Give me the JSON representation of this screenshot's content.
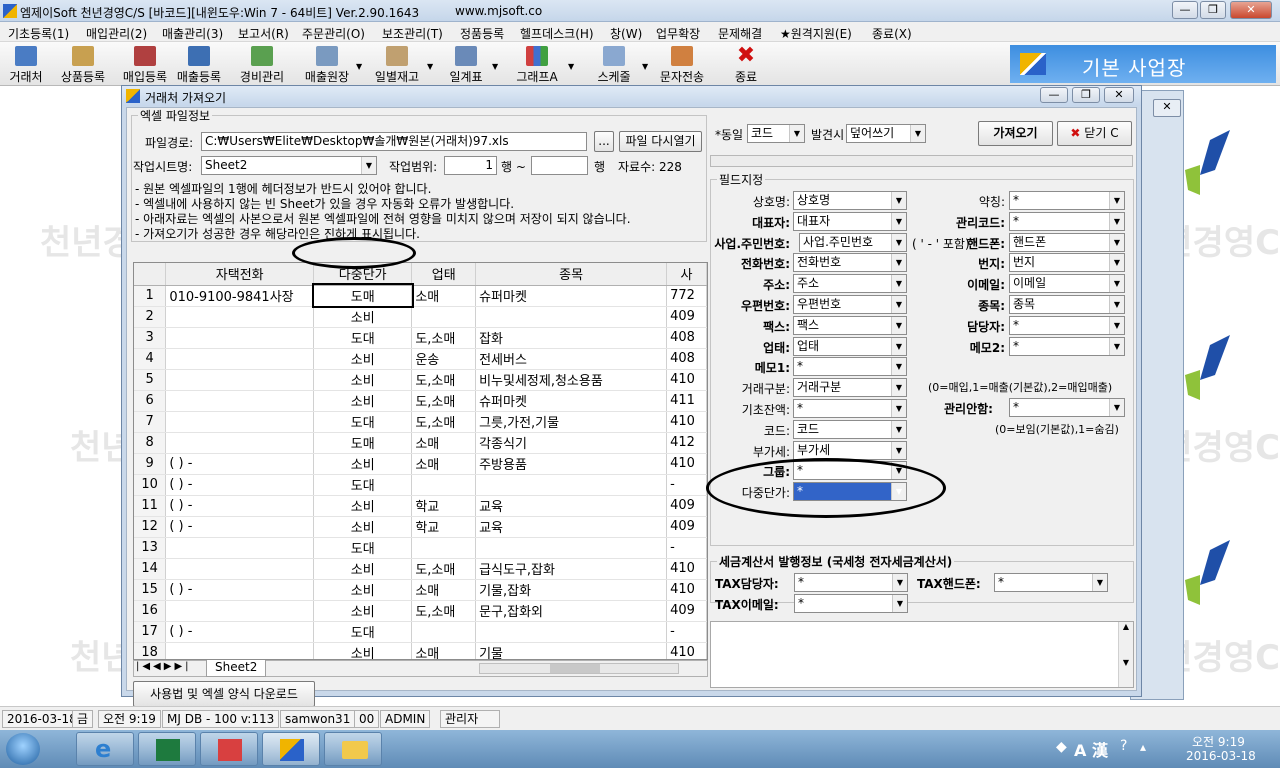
{
  "window": {
    "title": "엠제이Soft 천년경영C/S [바코드][내윈도우:Win 7 - 64비트] Ver.2.90.1643",
    "url": "www.mjsoft.co"
  },
  "menu": [
    "기초등록(1)",
    "매입관리(2)",
    "매출관리(3)",
    "보고서(R)",
    "주문관리(O)",
    "보조관리(T)",
    "정품등록",
    "헬프데스크(H)",
    "창(W)",
    "업무확장",
    "문제해결",
    "★원격지원(E)",
    "종료(X)"
  ],
  "toolbar": [
    "거래처",
    "상품등록",
    "매입등록",
    "매출등록",
    "경비관리",
    "매출원장",
    "일별재고",
    "일계표",
    "그래프A",
    "스케줄",
    "문자전송",
    "종료"
  ],
  "business_label": "기본 사업장",
  "background_watermark": "천년경영C/S",
  "dialog": {
    "title": "거래처 가져오기",
    "excel_group": "엑셀 파일정보",
    "filepath_label": "파일경로:",
    "filepath": "C:₩Users₩Elite₩Desktop₩솔개₩원본(거래처)97.xls",
    "browse": "...",
    "reopen": "파일 다시열기",
    "sheet_label": "작업시트명:",
    "sheet": "Sheet2",
    "range_label": "작업범위:",
    "range_from": "1",
    "row_from": "행 ~",
    "range_to": "",
    "row_to": "행",
    "count": "자료수: 228",
    "notes": [
      "- 원본 엑셀파일의 1행에 헤더정보가 반드시 있어야 합니다.",
      "- 엑셀내에 사용하지 않는 빈 Sheet가 있을 경우 자동화 오류가 발생합니다.",
      "- 아래자료는 엑셀의 사본으로서 원본 엑셀파일에 전혀 영향을 미치지 않으며 저장이 되지 않습니다.",
      "- 가져오기가 성공한 경우 해당라인은 진하게 표시됩니다."
    ],
    "grid_headers": [
      "",
      "자택전화",
      "다중단가",
      "업태",
      "종목",
      "사"
    ],
    "grid_rows": [
      [
        "1",
        "010-9100-9841사장",
        "도매",
        "소매",
        "슈퍼마켓",
        "772"
      ],
      [
        "2",
        "",
        "소비",
        "",
        "",
        "409"
      ],
      [
        "3",
        "",
        "도대",
        "도,소매",
        "잡화",
        "408"
      ],
      [
        "4",
        "",
        "소비",
        "운송",
        "전세버스",
        "408"
      ],
      [
        "5",
        "",
        "소비",
        "도,소매",
        "비누및세정제,청소용품",
        "410"
      ],
      [
        "6",
        "",
        "소비",
        "도,소매",
        "슈퍼마켓",
        "411"
      ],
      [
        "7",
        "",
        "도대",
        "도,소매",
        "그릇,가전,기물",
        "410"
      ],
      [
        "8",
        "",
        "도매",
        "소매",
        "각종식기",
        "412"
      ],
      [
        "9",
        "(  )    -",
        "소비",
        "소매",
        "주방용품",
        "410"
      ],
      [
        "10",
        "(  )    -",
        "도대",
        "",
        "",
        "-"
      ],
      [
        "11",
        "(  )    -",
        "소비",
        "학교",
        "교육",
        "409"
      ],
      [
        "12",
        "(  )    -",
        "소비",
        "학교",
        "교육",
        "409"
      ],
      [
        "13",
        "",
        "도대",
        "",
        "",
        "-"
      ],
      [
        "14",
        "",
        "소비",
        "도,소매",
        "급식도구,잡화",
        "410"
      ],
      [
        "15",
        "(  )    -",
        "소비",
        "소매",
        "기물,잡화",
        "410"
      ],
      [
        "16",
        "",
        "소비",
        "도,소매",
        "문구,잡화외",
        "409"
      ],
      [
        "17",
        "(  )    -",
        "도대",
        "",
        "",
        "-"
      ],
      [
        "18",
        "",
        "소비",
        "소매",
        "기물",
        "410"
      ]
    ],
    "sheet_tab": "Sheet2",
    "download_btn": "사용법 및 엑셀 양식 다운로드",
    "same_label": "*동일",
    "same_key": "코드",
    "found_label": "발견시",
    "found_action": "덮어쓰기",
    "import_btn": "가져오기",
    "close_btn": "닫기 C",
    "field_group": "필드지정",
    "fields_left": [
      {
        "label": "상호명:",
        "value": "상호명",
        "bold": false
      },
      {
        "label": "대표자:",
        "value": "대표자",
        "bold": true
      },
      {
        "label": "사업.주민번호:",
        "value": "사업.주민번호",
        "bold": true
      },
      {
        "label": "전화번호:",
        "value": "전화번호",
        "bold": true
      },
      {
        "label": "주소:",
        "value": "주소",
        "bold": true
      },
      {
        "label": "우편번호:",
        "value": "우편번호",
        "bold": true
      },
      {
        "label": "팩스:",
        "value": "팩스",
        "bold": true
      },
      {
        "label": "업태:",
        "value": "업태",
        "bold": true
      },
      {
        "label": "메모1:",
        "value": "*",
        "bold": true
      },
      {
        "label": "거래구분:",
        "value": "거래구분",
        "bold": false
      },
      {
        "label": "기초잔액:",
        "value": "*",
        "bold": false
      },
      {
        "label": "코드:",
        "value": "코드",
        "bold": false
      },
      {
        "label": "부가세:",
        "value": "부가세",
        "bold": false
      },
      {
        "label": "그룹:",
        "value": "*",
        "bold": true
      },
      {
        "label": "다중단가:",
        "value": "*",
        "bold": false
      }
    ],
    "fields_right": [
      {
        "label": "약칭:",
        "value": "*",
        "bold": false
      },
      {
        "label": "관리코드:",
        "value": "*",
        "bold": true
      },
      {
        "label": "핸드폰:",
        "value": "핸드폰",
        "bold": true
      },
      {
        "label": "번지:",
        "value": "번지",
        "bold": true
      },
      {
        "label": "이메일:",
        "value": "이메일",
        "bold": true
      },
      {
        "label": "종목:",
        "value": "종목",
        "bold": true
      },
      {
        "label": "담당자:",
        "value": "*",
        "bold": true
      },
      {
        "label": "메모2:",
        "value": "*",
        "bold": true
      }
    ],
    "biz_note": "( ' - ' 포함)",
    "trade_note": "(0=매입,1=매출(기본값),2=매입매출)",
    "mgmt_label": "관리안함:",
    "mgmt_value": "*",
    "mgmt_note": "(0=보임(기본값),1=숨김)",
    "tax_group": "세금계산서 발행정보 (국세청 전자세금계산서)",
    "tax_manager_label": "TAX담당자:",
    "tax_manager": "*",
    "tax_phone_label": "TAX핸드폰:",
    "tax_phone": "*",
    "tax_email_label": "TAX이메일:",
    "tax_email": "*"
  },
  "status": [
    "2016-03-18",
    "금",
    "오전 9:19",
    "MJ DB - 100 v:113",
    "samwon31",
    "00",
    "ADMIN",
    "관리자"
  ],
  "clock": {
    "time": "오전 9:19",
    "date": "2016-03-18"
  },
  "colors": {
    "accent": "#3d8ee0",
    "select": "#3264c8"
  }
}
